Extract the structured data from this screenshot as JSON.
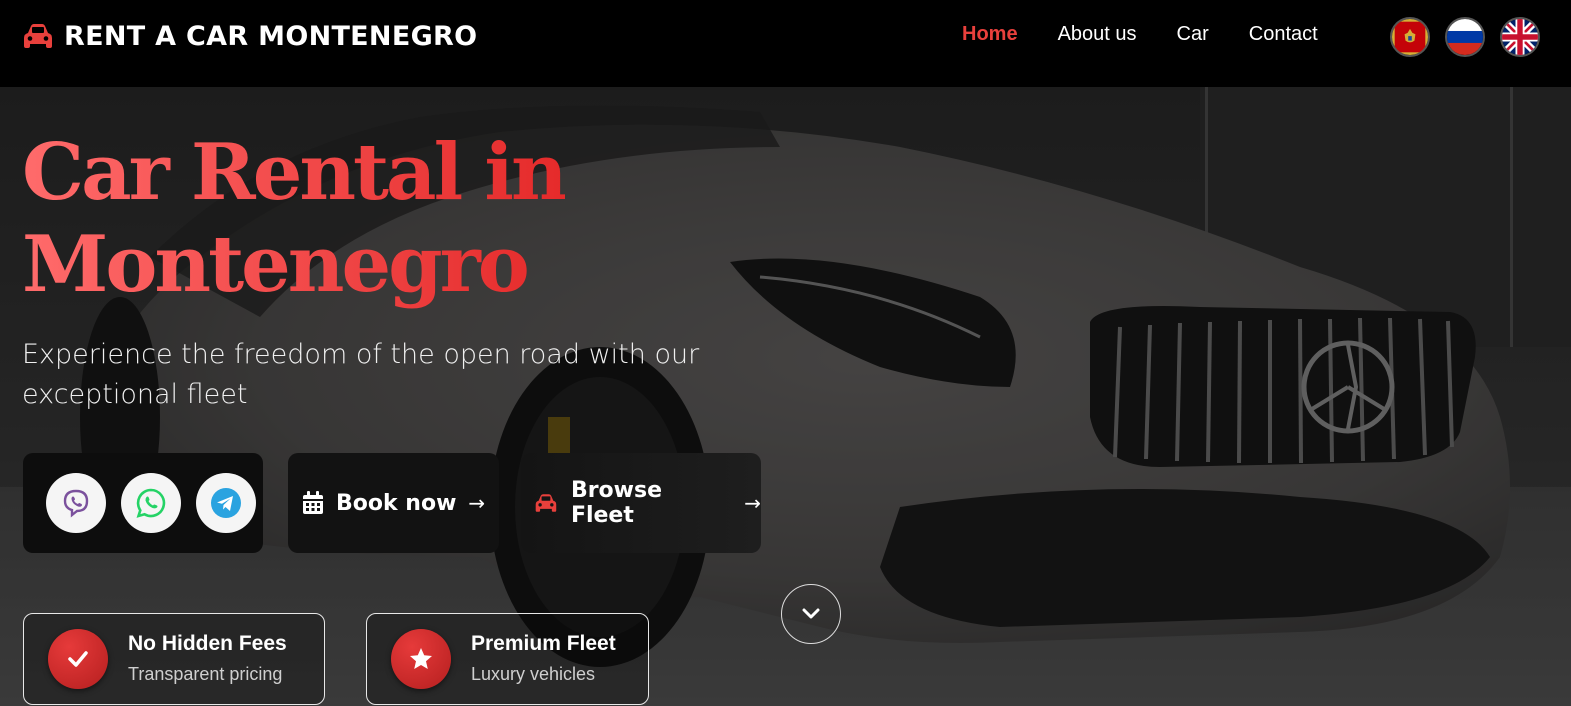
{
  "header": {
    "brand_icon": "car-icon",
    "brand_text": "RENT A CAR MONTENEGRO",
    "accent_color": "#e8403c",
    "nav": [
      {
        "label": "Home",
        "active": true
      },
      {
        "label": "About us",
        "active": false
      },
      {
        "label": "Car",
        "active": false
      },
      {
        "label": "Contact",
        "active": false
      }
    ],
    "languages": [
      {
        "icon": "montenegro-flag-icon"
      },
      {
        "icon": "russia-flag-icon"
      },
      {
        "icon": "uk-flag-icon"
      }
    ]
  },
  "hero": {
    "title_line1": "Car Rental in",
    "title_line2": "Montenegro",
    "subtitle": "Experience the freedom of the open road with our exceptional fleet",
    "messengers": [
      {
        "icon": "viber-icon",
        "color": "#7b519d"
      },
      {
        "icon": "whatsapp-icon",
        "color": "#25d366"
      },
      {
        "icon": "telegram-icon",
        "color": "#2aa3e0"
      }
    ],
    "book_now": {
      "label": "Book now",
      "icon": "calendar-icon",
      "arrow": "→"
    },
    "browse_fleet": {
      "label": "Browse Fleet",
      "icon": "car-icon",
      "arrow": "→"
    },
    "scroll_icon": "chevron-down-icon",
    "features": [
      {
        "title": "No Hidden Fees",
        "desc": "Transparent pricing",
        "icon": "check-icon"
      },
      {
        "title": "Premium Fleet",
        "desc": "Luxury vehicles",
        "icon": "star-icon"
      }
    ]
  }
}
